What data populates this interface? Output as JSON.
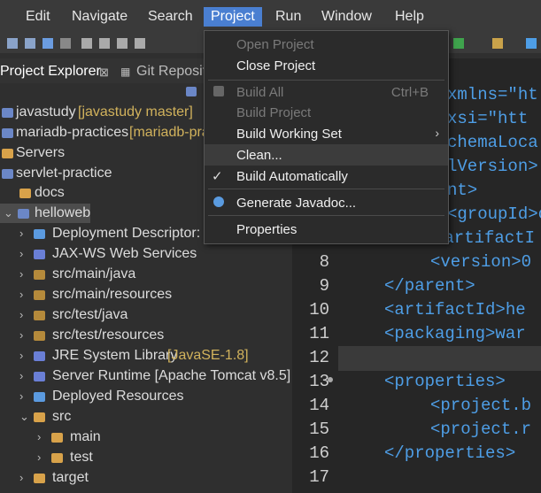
{
  "menubar": {
    "items": [
      "Edit",
      "Navigate",
      "Search",
      "Project",
      "Run",
      "Window",
      "Help"
    ]
  },
  "tabs": {
    "project_explorer": "Project Explorer",
    "git": "Git Reposit"
  },
  "tree": {
    "javastudy": "javastudy",
    "javastudy_deco": "[javastudy master]",
    "mariadb": "mariadb-practices",
    "mariadb_deco": "[mariadb-pra",
    "servers": "Servers",
    "servlet": "servlet-practice",
    "docs": "docs",
    "helloweb": "helloweb",
    "deployment": "Deployment Descriptor: h",
    "jaxws": "JAX-WS Web Services",
    "src_main_java": "src/main/java",
    "src_main_resources": "src/main/resources",
    "src_test_java": "src/test/java",
    "src_test_resources": "src/test/resources",
    "jre": "JRE System Library",
    "jre_deco": "[JavaSE-1.8]",
    "server_runtime": "Server Runtime [Apache Tomcat v8.5]",
    "deployed": "Deployed Resources",
    "src": "src",
    "main": "main",
    "test": "test",
    "target": "target"
  },
  "editor": {
    "lines": [
      "8",
      "9",
      "10",
      "11",
      "12",
      "13",
      "14",
      "15",
      "16",
      "17"
    ],
    "code": {
      "l1": "xmlns=\"ht",
      "l2": "xsi=\"htt",
      "l3": "chemaLoca",
      "l4": "lVersion>",
      "l5": "nt>",
      "l6": "<groupId>c",
      "l7": "<artifactI",
      "l8": "<version>0",
      "l9": "</parent>",
      "l10": "<artifactId>he",
      "l11": "<packaging>war",
      "l13": "<properties>",
      "l14": "<project.b",
      "l15": "<project.r",
      "l16": "</properties>"
    }
  },
  "project_menu": {
    "open_project": "Open Project",
    "close_project": "Close Project",
    "build_all": "Build All",
    "build_all_shortcut": "Ctrl+B",
    "build_project": "Build Project",
    "build_working_set": "Build Working Set",
    "clean": "Clean...",
    "build_automatically": "Build Automatically",
    "generate_javadoc": "Generate Javadoc...",
    "properties": "Properties"
  }
}
